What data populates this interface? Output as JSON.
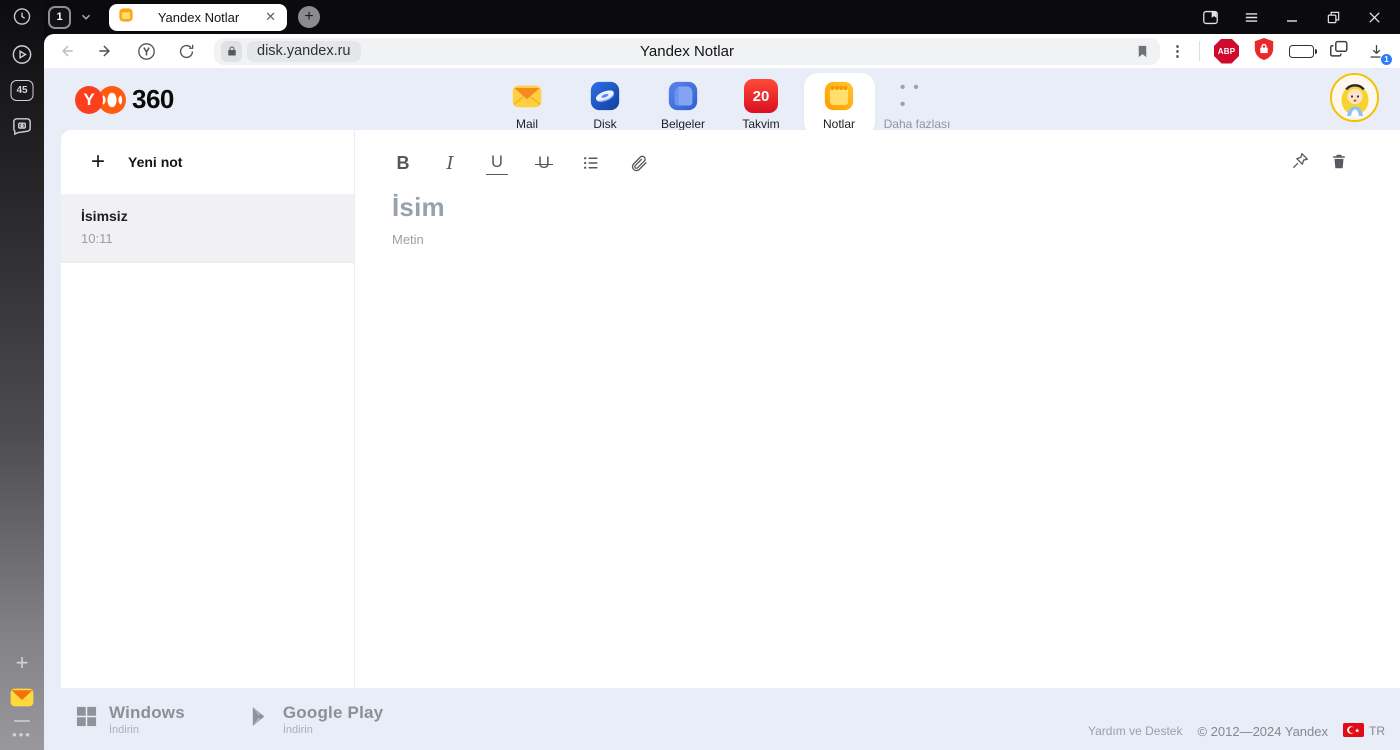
{
  "browser": {
    "tab_counter": "1",
    "tab_title": "Yandex Notlar",
    "url": "disk.yandex.ru",
    "page_title": "Yandex Notlar",
    "abp_label": "ABP",
    "download_badge": "1"
  },
  "rail": {
    "badge": "45"
  },
  "header": {
    "logo_letter": "Y",
    "logo_suffix": "360",
    "apps": [
      {
        "id": "mail",
        "label": "Mail"
      },
      {
        "id": "disk",
        "label": "Disk"
      },
      {
        "id": "docs",
        "label": "Belgeler"
      },
      {
        "id": "calendar",
        "label": "Takvim",
        "badge": "20"
      },
      {
        "id": "notes",
        "label": "Notlar",
        "active": true
      },
      {
        "id": "more",
        "label": "Daha fazlası",
        "muted": true
      }
    ]
  },
  "notes_panel": {
    "new_note_label": "Yeni not",
    "notes": [
      {
        "title": "İsimsiz",
        "time": "10:11",
        "selected": true
      }
    ]
  },
  "editor": {
    "bold": "B",
    "italic": "I",
    "underline": "U",
    "strike": "U",
    "title_placeholder": "İsim",
    "body_placeholder": "Metin"
  },
  "footer": {
    "badges": [
      {
        "id": "windows",
        "title": "Windows",
        "subtitle": "İndirin"
      },
      {
        "id": "gplay",
        "title": "Google Play",
        "subtitle": "İndirin"
      }
    ],
    "help": "Yardım ve Destek",
    "copyright": "© 2012—2024 Yandex",
    "lang": "TR"
  },
  "colors": {
    "page_bg": "#e9edf8",
    "accent_blue": "#2b7cf6",
    "calendar_red": "#e02030",
    "notes_orange": "#ffb020",
    "abp_red": "#cf0a2c",
    "shield_red": "#e8282d",
    "battery_orange": "#ff9f0a",
    "avatar_ring": "#f2c200",
    "yandex_red": "#fc3f1d"
  }
}
